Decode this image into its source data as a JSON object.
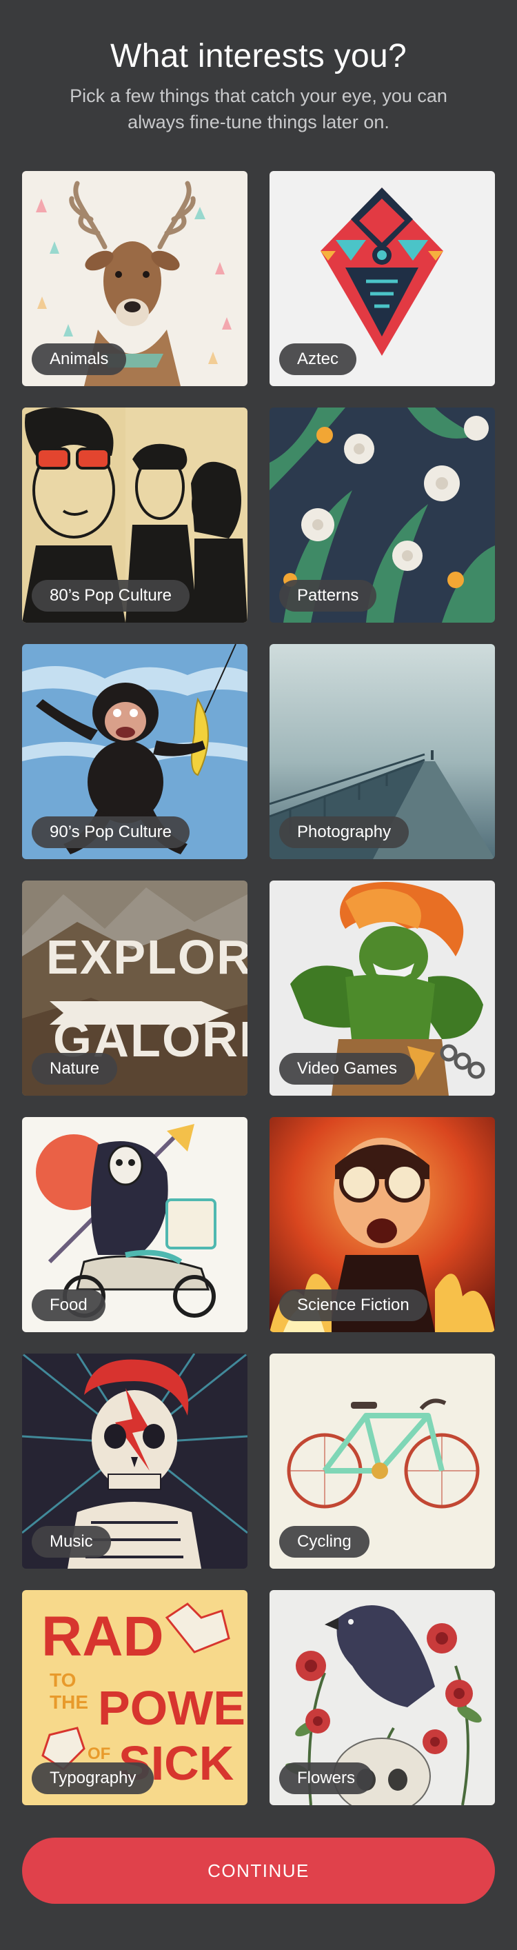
{
  "header": {
    "title": "What interests you?",
    "subtitle": "Pick a few things that catch your eye, you can always fine-tune things later on."
  },
  "categories": [
    {
      "label": "Animals",
      "icon": "deer-illustration"
    },
    {
      "label": "Aztec",
      "icon": "aztec-diamond-illustration"
    },
    {
      "label": "80’s Pop Culture",
      "icon": "80s-characters-illustration"
    },
    {
      "label": "Patterns",
      "icon": "dandelion-pattern"
    },
    {
      "label": "90’s Pop Culture",
      "icon": "monkey-banana-illustration"
    },
    {
      "label": "Photography",
      "icon": "foggy-bridge-photo"
    },
    {
      "label": "Nature",
      "icon": "explore-galore-mountains"
    },
    {
      "label": "Video Games",
      "icon": "green-fighter-illustration"
    },
    {
      "label": "Food",
      "icon": "skeleton-pizza-scooter"
    },
    {
      "label": "Science Fiction",
      "icon": "fiery-goggles-boy"
    },
    {
      "label": "Music",
      "icon": "bowie-skull-illustration"
    },
    {
      "label": "Cycling",
      "icon": "mint-bicycle"
    },
    {
      "label": "Typography",
      "icon": "rad-power-sick-lettering"
    },
    {
      "label": "Flowers",
      "icon": "raven-roses-skull"
    }
  ],
  "footer": {
    "continue_label": "CONTINUE"
  },
  "colors": {
    "background": "#3a3b3d",
    "accent": "#e0414b",
    "pill": "#424244"
  }
}
